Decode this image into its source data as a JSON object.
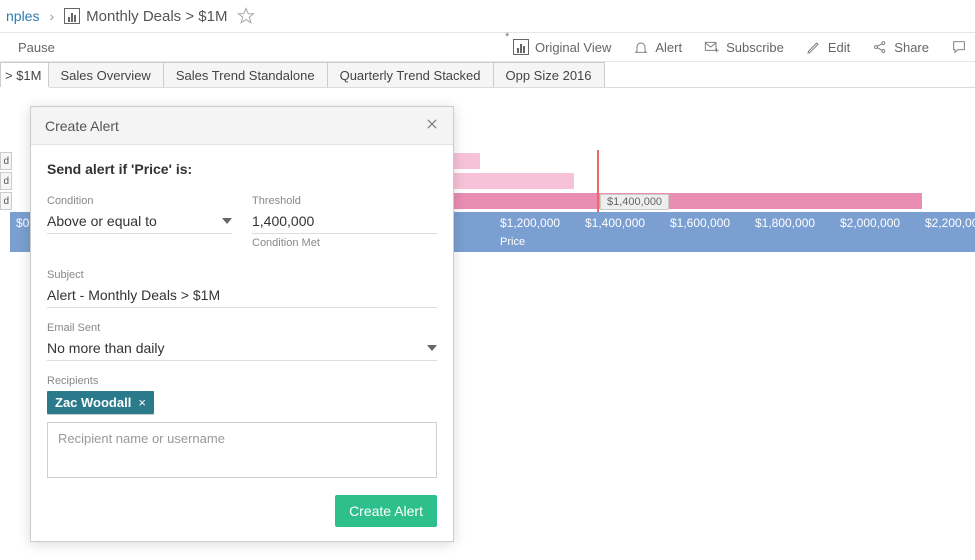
{
  "breadcrumb": {
    "parent_partial": "nples",
    "title": "Monthly Deals > $1M"
  },
  "toolbar": {
    "pause": "Pause",
    "original_view": "Original View",
    "alert": "Alert",
    "subscribe": "Subscribe",
    "edit": "Edit",
    "share": "Share"
  },
  "tabs": {
    "active_partial": "> $1M",
    "items": [
      "Sales Overview",
      "Sales Trend Standalone",
      "Quarterly Trend Stacked",
      "Opp Size 2016"
    ]
  },
  "chart_data": {
    "type": "bar",
    "axis_label": "Price",
    "axis_ticks": [
      "$0",
      "$1,200,000",
      "$1,400,000",
      "$1,600,000",
      "$1,800,000",
      "$2,000,000",
      "$2,200,000"
    ],
    "row_label_stub": "d",
    "reference_line_value": "$1,400,000",
    "bars_approx_end": [
      1070000,
      1280000,
      2130000
    ]
  },
  "modal": {
    "title": "Create Alert",
    "heading": "Send alert if 'Price' is:",
    "condition_label": "Condition",
    "condition_value": "Above or equal to",
    "threshold_label": "Threshold",
    "threshold_value": "1,400,000",
    "threshold_status": "Condition Met",
    "subject_label": "Subject",
    "subject_value": "Alert - Monthly Deals > $1M",
    "email_label": "Email Sent",
    "email_value": "No more than daily",
    "recipients_label": "Recipients",
    "recipient_chip": "Zac Woodall",
    "recipient_placeholder": "Recipient name or username",
    "submit": "Create Alert"
  }
}
